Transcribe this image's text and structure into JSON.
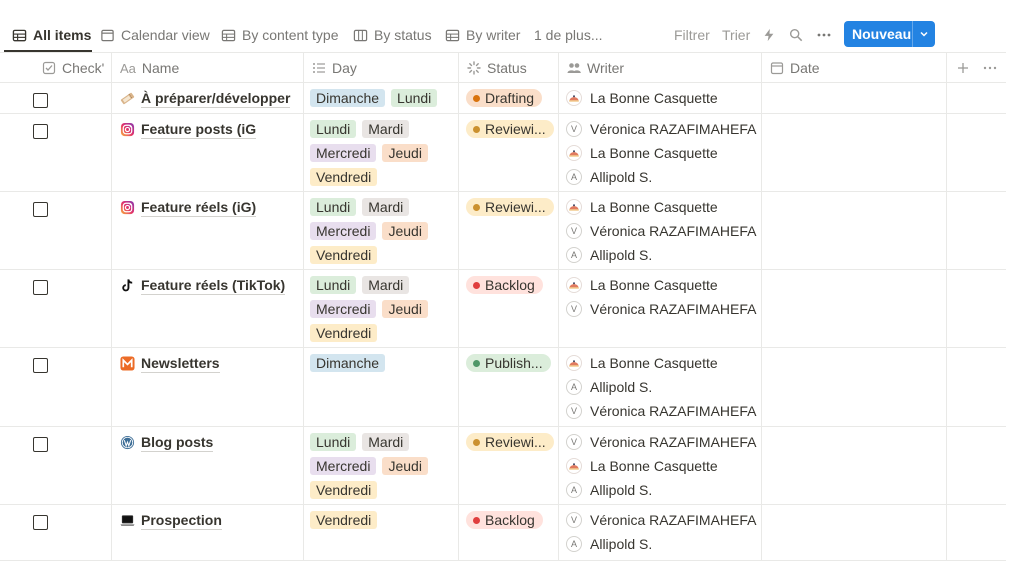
{
  "tabs": [
    {
      "label": "All items",
      "icon": "table-icon",
      "active": true
    },
    {
      "label": "Calendar view",
      "icon": "calendar-icon"
    },
    {
      "label": "By content type",
      "icon": "table-icon"
    },
    {
      "label": "By status",
      "icon": "board-icon"
    },
    {
      "label": "By writer",
      "icon": "table-icon"
    },
    {
      "label": "1 de plus..."
    }
  ],
  "toolbar": {
    "filter": "Filtrer",
    "sort": "Trier",
    "automation_icon": "lightning-icon",
    "search_icon": "search-icon",
    "more_icon": "more-icon",
    "new_label": "Nouveau",
    "accent": "#2383e2"
  },
  "columns": [
    {
      "label": "Check'",
      "icon": "checkbox-icon"
    },
    {
      "label": "Name",
      "icon": "text-icon",
      "prefix": "Aa"
    },
    {
      "label": "Day",
      "icon": "list-icon"
    },
    {
      "label": "Status",
      "icon": "status-icon"
    },
    {
      "label": "Writer",
      "icon": "people-icon"
    },
    {
      "label": "Date",
      "icon": "calendar-icon"
    }
  ],
  "rows": [
    {
      "name": "À préparer/développer",
      "icon": "ticket-icon",
      "days": [
        "Dimanche",
        "Lundi"
      ],
      "status": "Drafting",
      "status_kind": "drafting",
      "writers": [
        {
          "name": "La Bonne Casquette",
          "avatar": "cap"
        }
      ]
    },
    {
      "name": "Feature posts (iG",
      "icon": "instagram-icon",
      "days": [
        "Lundi",
        "Mardi",
        "Mercredi",
        "Jeudi",
        "Vendredi"
      ],
      "status": "Reviewi...",
      "status_kind": "review",
      "writers": [
        {
          "name": "Véronica RAZAFIMAHEFA",
          "avatar": "V"
        },
        {
          "name": "La Bonne Casquette",
          "avatar": "cap"
        },
        {
          "name": "Allipold S.",
          "avatar": "A"
        }
      ]
    },
    {
      "name": "Feature réels (iG)",
      "icon": "instagram-icon",
      "days": [
        "Lundi",
        "Mardi",
        "Mercredi",
        "Jeudi",
        "Vendredi"
      ],
      "status": "Reviewi...",
      "status_kind": "review",
      "writers": [
        {
          "name": "La Bonne Casquette",
          "avatar": "cap"
        },
        {
          "name": "Véronica RAZAFIMAHEFA",
          "avatar": "V"
        },
        {
          "name": "Allipold S.",
          "avatar": "A"
        }
      ]
    },
    {
      "name": "Feature réels (TikTok)",
      "icon": "tiktok-icon",
      "days": [
        "Lundi",
        "Mardi",
        "Mercredi",
        "Jeudi",
        "Vendredi"
      ],
      "status": "Backlog",
      "status_kind": "backlog",
      "writers": [
        {
          "name": "La Bonne Casquette",
          "avatar": "cap"
        },
        {
          "name": "Véronica RAZAFIMAHEFA",
          "avatar": "V"
        }
      ]
    },
    {
      "name": "Newsletters",
      "icon": "mail-icon",
      "days": [
        "Dimanche"
      ],
      "status": "Publish...",
      "status_kind": "publish",
      "writers": [
        {
          "name": "La Bonne Casquette",
          "avatar": "cap"
        },
        {
          "name": "Allipold S.",
          "avatar": "A"
        },
        {
          "name": "Véronica RAZAFIMAHEFA",
          "avatar": "V"
        }
      ]
    },
    {
      "name": "Blog posts",
      "icon": "wordpress-icon",
      "days": [
        "Lundi",
        "Mardi",
        "Mercredi",
        "Jeudi",
        "Vendredi"
      ],
      "status": "Reviewi...",
      "status_kind": "review",
      "writers": [
        {
          "name": "Véronica RAZAFIMAHEFA",
          "avatar": "V"
        },
        {
          "name": "La Bonne Casquette",
          "avatar": "cap"
        },
        {
          "name": "Allipold S.",
          "avatar": "A"
        }
      ]
    },
    {
      "name": "Prospection",
      "icon": "laptop-icon",
      "days": [
        "Vendredi"
      ],
      "status": "Backlog",
      "status_kind": "backlog",
      "writers": [
        {
          "name": "Véronica RAZAFIMAHEFA",
          "avatar": "V"
        },
        {
          "name": "Allipold S.",
          "avatar": "A"
        }
      ]
    }
  ]
}
